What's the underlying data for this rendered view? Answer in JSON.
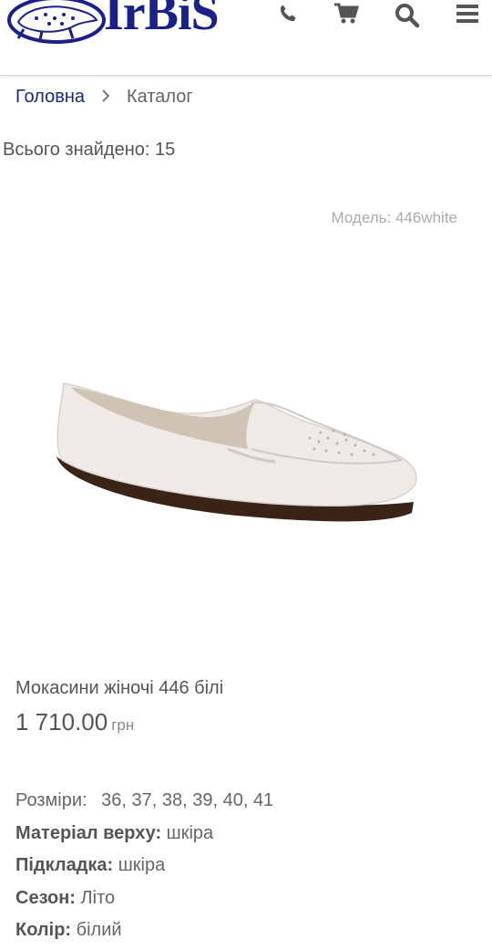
{
  "header": {
    "logo_text": "IrBiS",
    "icons": [
      "phone-icon",
      "cart-icon",
      "search-icon",
      "menu-icon"
    ],
    "brand_color": "#1b1f8a"
  },
  "breadcrumb": {
    "home": "Головна",
    "current": "Каталог"
  },
  "results": {
    "found_text": "Всього знайдено: 15"
  },
  "product": {
    "model": "Модель: 446white",
    "name": "Мокасини жіночі 446 білі",
    "price": "1 710.00",
    "currency": "грн",
    "sizes_label": "Розміри:",
    "sizes": "36, 37, 38, 39, 40, 41",
    "attributes": [
      {
        "label": "Матеріал верху:",
        "value": "шкіра"
      },
      {
        "label": "Підкладка:",
        "value": "шкіра"
      },
      {
        "label": "Сезон:",
        "value": "Літо"
      },
      {
        "label": "Колір:",
        "value": "білий"
      }
    ]
  }
}
